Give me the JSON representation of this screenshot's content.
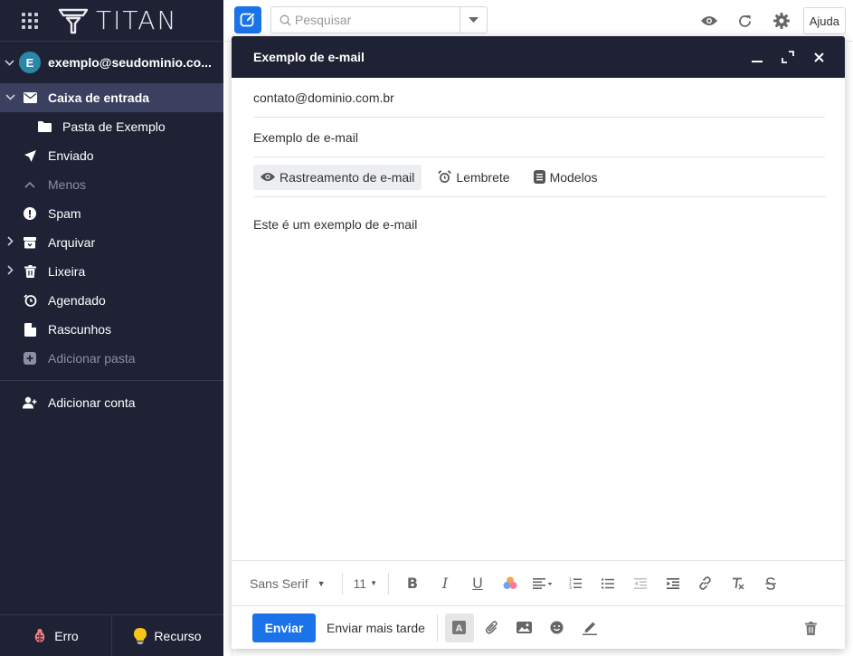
{
  "app": {
    "name": "TITAN"
  },
  "sidebar": {
    "account": {
      "initial": "E",
      "email": "exemplo@seudominio.co..."
    },
    "items": [
      {
        "label": "Caixa de entrada"
      },
      {
        "label": "Pasta de Exemplo"
      },
      {
        "label": "Enviado"
      },
      {
        "label": "Menos"
      },
      {
        "label": "Spam"
      },
      {
        "label": "Arquivar"
      },
      {
        "label": "Lixeira"
      },
      {
        "label": "Agendado"
      },
      {
        "label": "Rascunhos"
      },
      {
        "label": "Adicionar pasta"
      }
    ],
    "add_account_label": "Adicionar conta",
    "footer": {
      "bug_label": "Erro",
      "feature_label": "Recurso"
    }
  },
  "topbar": {
    "search_placeholder": "Pesquisar",
    "help_label": "Ajuda"
  },
  "compose": {
    "title": "Exemplo de e-mail",
    "to": "contato@dominio.com.br",
    "subject": "Exemplo de e-mail",
    "tools": {
      "tracking_label": "Rastreamento de e-mail",
      "reminder_label": "Lembrete",
      "templates_label": "Modelos"
    },
    "body": "Este é um exemplo de e-mail",
    "format": {
      "font": "Sans Serif",
      "size": "11",
      "bold": "B",
      "italic": "I",
      "underline": "U"
    },
    "send_label": "Enviar",
    "send_later_label": "Enviar mais tarde"
  },
  "colors": {
    "sidebar_bg": "#1f2235",
    "accent": "#1a73e8",
    "active_item": "#3c4060",
    "avatar": "#2b87a8"
  }
}
